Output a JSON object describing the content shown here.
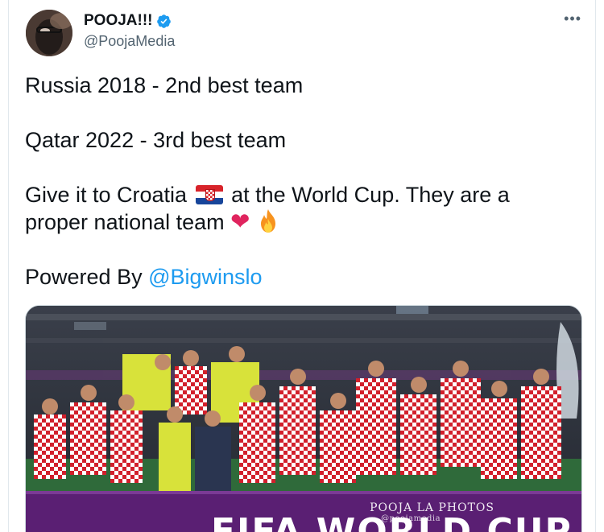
{
  "author": {
    "display_name": "POOJA!!!",
    "handle": "@PoojaMedia",
    "verified": true
  },
  "menu": {
    "more_label": "•••"
  },
  "tweet": {
    "line1": "Russia 2018 - 2nd best team",
    "line2": "Qatar 2022 - 3rd best team",
    "line3_before_flag": "Give it to Croatia",
    "line3_after_flag": "at the World Cup. They are a",
    "line4": "proper national team",
    "powered_prefix": "Powered By",
    "powered_mention": "@Bigwinslo",
    "emoji": [
      "croatia-flag",
      "red-heart",
      "fire"
    ]
  },
  "media": {
    "banner_text": "FIFA WORLD CUP",
    "watermark": "POOJA LA PHOTOS",
    "watermark_sub": "@poojamedia"
  },
  "colors": {
    "accent": "#1d9bf0",
    "text": "#0f1419",
    "secondary": "#536471",
    "heart": "#e0245e",
    "banner": "#5a1f73"
  }
}
